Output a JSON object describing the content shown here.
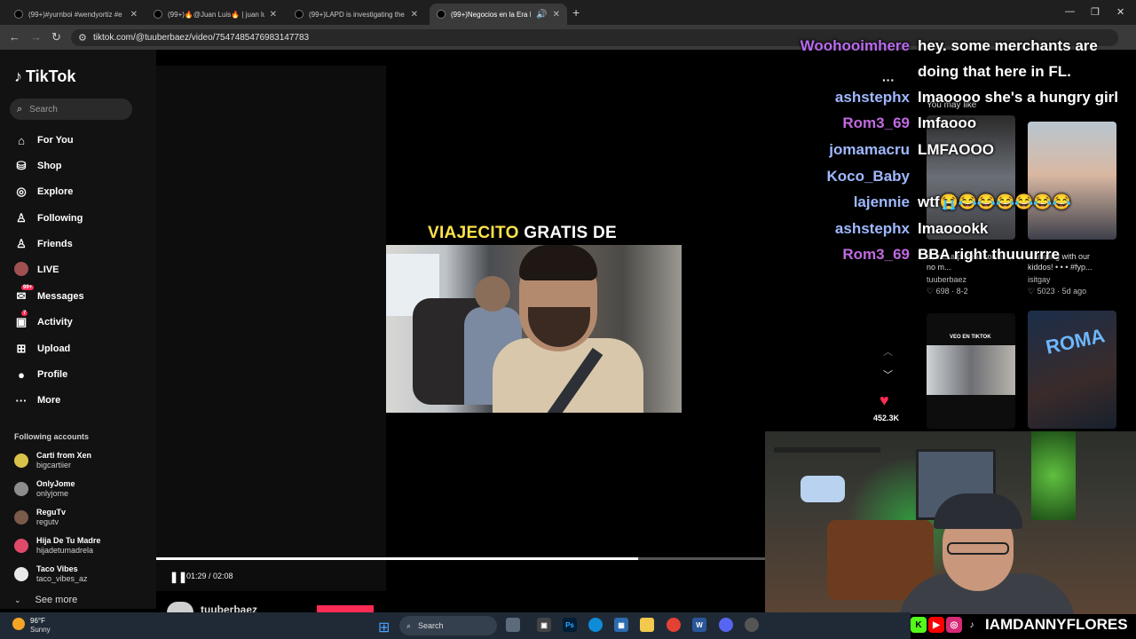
{
  "browser": {
    "tabs": [
      {
        "title": "(99+)#yurnboi #wendyortiz #e"
      },
      {
        "title": "(99+)🔥@Juan Luis🔥 | juan lu"
      },
      {
        "title": "(99+)LAPD is investigating the"
      },
      {
        "title": "(99+)Negocios en la Era Di"
      }
    ],
    "new_tab": "+",
    "url": "tiktok.com/@tuuberbaez/video/7547485476983147783",
    "win_min": "—",
    "win_max": "❐",
    "win_close": "✕"
  },
  "sidebar": {
    "logo": "TikTok",
    "search_placeholder": "Search",
    "nav": [
      {
        "label": "For You",
        "icon": "home-icon",
        "glyph": "⌂"
      },
      {
        "label": "Shop",
        "icon": "shop-icon",
        "glyph": "🛍"
      },
      {
        "label": "Explore",
        "icon": "explore-icon",
        "glyph": "◎"
      },
      {
        "label": "Following",
        "icon": "following-icon",
        "glyph": "👤"
      },
      {
        "label": "Friends",
        "icon": "friends-icon",
        "glyph": "👥"
      },
      {
        "label": "LIVE",
        "icon": "live-icon",
        "glyph": ""
      },
      {
        "label": "Messages",
        "icon": "messages-icon",
        "glyph": "✉",
        "badge": "99+"
      },
      {
        "label": "Activity",
        "icon": "activity-icon",
        "glyph": "✉",
        "badge": "7"
      },
      {
        "label": "Upload",
        "icon": "upload-icon",
        "glyph": "⊞"
      },
      {
        "label": "Profile",
        "icon": "profile-icon",
        "glyph": "●"
      },
      {
        "label": "More",
        "icon": "more-icon",
        "glyph": "···"
      }
    ],
    "following_header": "Following accounts",
    "accounts": [
      {
        "name": "Carti from Xen",
        "user": "bigcartiier",
        "color": "#d8c24a"
      },
      {
        "name": "OnlyJome",
        "user": "onlyjome",
        "color": "#8d8d8d"
      },
      {
        "name": "ReguTv",
        "user": "regutv",
        "color": "#7a5a48"
      },
      {
        "name": "Hija De Tu Madre",
        "user": "hijadetumadrela",
        "color": "#e04a6a"
      },
      {
        "name": "Taco Vibes",
        "user": "taco_vibes_az",
        "color": "#e9e9e9"
      }
    ],
    "see_more": "See more"
  },
  "video": {
    "caption_yellow": "VIAJECITO",
    "caption_white": "GRATIS DE",
    "time": "01:29 / 02:08",
    "progress": 0.86,
    "creator": "tuuberbaez",
    "likes": "452.3K"
  },
  "recommendations": {
    "header": "You may like",
    "items": [
      {
        "caption": "Si vas a pistear con él no m...",
        "user": "tuuberbaez",
        "stats": "♡ 698 · 8-2"
      },
      {
        "caption": "Camping with our kiddos! • • • #fyp...",
        "user": "isitgay",
        "stats": "♡ 5023 · 5d ago"
      },
      {
        "caption": "",
        "user": "",
        "stats": "",
        "overlay": "VEO EN TIKTOK"
      },
      {
        "caption": "",
        "user": "",
        "stats": "",
        "overlay": "ROMA"
      }
    ]
  },
  "chat": [
    {
      "name": "Woohooimhere",
      "msg": "hey. some merchants are",
      "color": "#b96af0"
    },
    {
      "name": "",
      "msg": "doing that here in FL.",
      "color": "#ffffff"
    },
    {
      "name": "ashstephx",
      "msg": "lmaoooo she's a hungry girl",
      "color": "#9fb8ff"
    },
    {
      "name": "Rom3_69",
      "msg": "lmfaooo",
      "color": "#c06ae0"
    },
    {
      "name": "jomamacru",
      "msg": "LMFAOOO",
      "color": "#9fb8ff"
    },
    {
      "name": "Koco_Baby",
      "msg": "wtf😭😂😂😂😂😂😂",
      "color": "#9fb8ff"
    },
    {
      "name": "lajennie",
      "msg": "lmaoookk",
      "color": "#9fb8ff"
    },
    {
      "name": "ashstephx",
      "msg": "BBA right thuuurrre",
      "color": "#9fb8ff"
    },
    {
      "name": "Rom3_69",
      "msg": "",
      "color": "#c06ae0"
    }
  ],
  "stream": {
    "handle": "IAMDANNYFLORES"
  },
  "taskbar": {
    "temp": "96°F",
    "condition": "Sunny",
    "search": "Search"
  }
}
